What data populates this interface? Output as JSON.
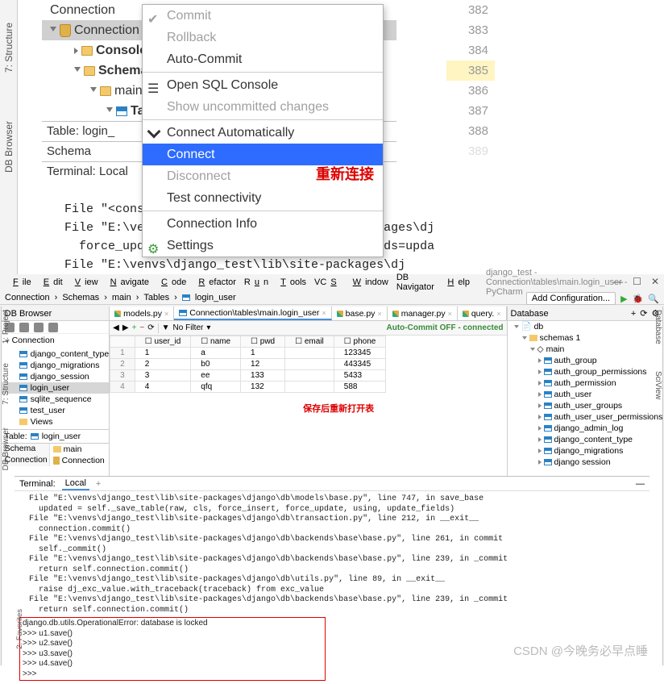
{
  "top": {
    "rails": {
      "structure": "7: Structure",
      "dbbrowser": "DB Browser"
    },
    "tree": {
      "r0": "Connection",
      "r1": "Connection",
      "r2": "Console",
      "r3": "Schema",
      "r4": "main",
      "r5": "Ta"
    },
    "table_line": "Table:    login_",
    "schema_line": "Schema",
    "terminal_line": "Terminal:    Local",
    "gutter": [
      "382",
      "383",
      "384",
      "385",
      "386",
      "387",
      "388",
      "389"
    ],
    "ctx": {
      "commit": "Commit",
      "rollback": "Rollback",
      "autocommit": "Auto-Commit",
      "opensql": "Open SQL Console",
      "showun": "Show uncommitted changes",
      "connauto": "Connect Automatically",
      "connect": "Connect",
      "disconnect": "Disconnect",
      "testconn": "Test connectivity",
      "conninfo": "Connection Info",
      "settings": "Settings"
    },
    "annotation": "重新连接",
    "code": "  File \"<cons\n  File \"E:\\ve                              ackages\\dj\n    force_upd                              ields=upda\n  File \"E:\\venvs\\django_test\\lib\\site-packages\\dj"
  },
  "bot": {
    "menu": [
      "File",
      "Edit",
      "View",
      "Navigate",
      "Code",
      "Refactor",
      "Run",
      "Tools",
      "VCS",
      "Window",
      "DB Navigator",
      "Help"
    ],
    "title_path": "django_test - Connection\\tables\\main.login_user - PyCharm",
    "breadcrumb": [
      "Connection",
      "Schemas",
      "main",
      "Tables",
      "login_user"
    ],
    "addcfg": "Add Configuration...",
    "dbb_title": "DB Browser",
    "conn_label": "Connection",
    "tree_items": [
      "django_content_type",
      "django_migrations",
      "django_session",
      "login_user",
      "sqlite_sequence",
      "test_user",
      "Views"
    ],
    "table_row_label": "Table:",
    "table_row_value": "login_user",
    "schema_rows": [
      {
        "k": "Schema",
        "v": "main",
        "ico": "folder"
      },
      {
        "k": "Connection",
        "v": "Connection",
        "ico": "db"
      }
    ],
    "editor_tabs": [
      {
        "label": "models.py",
        "ico": "py"
      },
      {
        "label": "Connection\\tables\\main.login_user",
        "ico": "tbl",
        "sel": true
      },
      {
        "label": "base.py",
        "ico": "py"
      },
      {
        "label": "manager.py",
        "ico": "py"
      },
      {
        "label": "query.",
        "ico": "py"
      }
    ],
    "data_toolbar": {
      "nofilter": "No Filter",
      "status": "Auto-Commit OFF - connected"
    },
    "columns": [
      "user_id",
      "name",
      "pwd",
      "email",
      "phone"
    ],
    "rows": [
      [
        "1",
        "a",
        "1",
        "",
        "123345"
      ],
      [
        "2",
        "b0",
        "12",
        "",
        "443345"
      ],
      [
        "3",
        "ee",
        "133",
        "",
        "5433"
      ],
      [
        "4",
        "qfq",
        "132",
        "",
        "588"
      ]
    ],
    "annotation2": "保存后重新打开表",
    "database_title": "Database",
    "db_root": "db",
    "db_schemas": "schemas",
    "db_main": "main",
    "db_items": [
      "auth_group",
      "auth_group_permissions",
      "auth_permission",
      "auth_user",
      "auth_user_groups",
      "auth_user_user_permissions",
      "django_admin_log",
      "django_content_type",
      "django_migrations",
      "django session"
    ],
    "terminal_title": "Terminal:",
    "terminal_tab": "Local",
    "term_lines": [
      "  File \"E:\\venvs\\django_test\\lib\\site-packages\\django\\db\\models\\base.py\", line 747, in save_base",
      "    updated = self._save_table(raw, cls, force_insert, force_update, using, update_fields)",
      "  File \"E:\\venvs\\django_test\\lib\\site-packages\\django\\db\\transaction.py\", line 212, in __exit__",
      "    connection.commit()",
      "  File \"E:\\venvs\\django_test\\lib\\site-packages\\django\\db\\backends\\base\\base.py\", line 261, in commit",
      "    self._commit()",
      "  File \"E:\\venvs\\django_test\\lib\\site-packages\\django\\db\\backends\\base\\base.py\", line 239, in _commit",
      "    return self.connection.commit()",
      "  File \"E:\\venvs\\django_test\\lib\\site-packages\\django\\db\\utils.py\", line 89, in __exit__",
      "    raise dj_exc_value.with_traceback(traceback) from exc_value",
      "  File \"E:\\venvs\\django_test\\lib\\site-packages\\django\\db\\backends\\base\\base.py\", line 239, in _commit",
      "    return self.connection.commit()"
    ],
    "term_box": [
      "django.db.utils.OperationalError: database is locked",
      ">>> u1.save()",
      ">>> u2.save()",
      ">>> u3.save()",
      ">>> u4.save()",
      ">>> "
    ],
    "favorites_rail": "2: Favorites",
    "watermark": "CSDN @今晚务必早点睡"
  }
}
